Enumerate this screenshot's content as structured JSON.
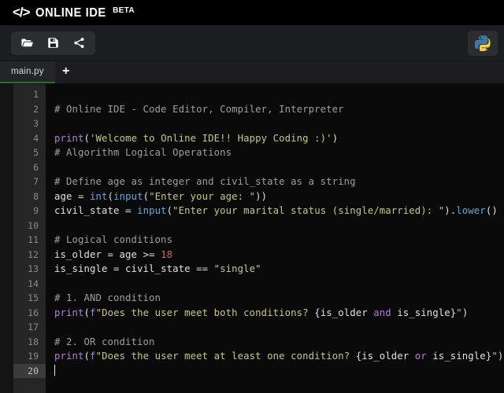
{
  "header": {
    "code_glyph": "</>",
    "title": "ONLINE IDE",
    "badge": "BETA"
  },
  "toolbar": {
    "buttons": [
      {
        "name": "open-file-button",
        "icon": "folder-open-icon",
        "label": "Open"
      },
      {
        "name": "save-file-button",
        "icon": "save-icon",
        "label": "Save"
      },
      {
        "name": "share-button",
        "icon": "share-icon",
        "label": "Share"
      }
    ],
    "language_badge": {
      "icon": "python-logo-icon",
      "label": "Python"
    }
  },
  "tabs": {
    "items": [
      {
        "label": "main.py",
        "active": true
      }
    ],
    "add_label": "+"
  },
  "editor": {
    "language": "python",
    "active_line": 20,
    "total_lines": 20,
    "line_numbers": [
      1,
      2,
      3,
      4,
      5,
      6,
      7,
      8,
      9,
      10,
      11,
      12,
      13,
      14,
      15,
      16,
      17,
      18,
      19,
      20
    ],
    "lines": [
      {
        "num": 1,
        "text": ""
      },
      {
        "num": 2,
        "text": "# Online IDE - Code Editor, Compiler, Interpreter"
      },
      {
        "num": 3,
        "text": ""
      },
      {
        "num": 4,
        "text": "print('Welcome to Online IDE!! Happy Coding :)')"
      },
      {
        "num": 5,
        "text": "# Algorithm Logical Operations"
      },
      {
        "num": 6,
        "text": ""
      },
      {
        "num": 7,
        "text": "# Define age as integer and civil_state as a string"
      },
      {
        "num": 8,
        "text": "age = int(input(\"Enter your age: \"))"
      },
      {
        "num": 9,
        "text": "civil_state = input(\"Enter your marital status (single/married): \").lower()"
      },
      {
        "num": 10,
        "text": ""
      },
      {
        "num": 11,
        "text": "# Logical conditions"
      },
      {
        "num": 12,
        "text": "is_older = age >= 18"
      },
      {
        "num": 13,
        "text": "is_single = civil_state == \"single\""
      },
      {
        "num": 14,
        "text": ""
      },
      {
        "num": 15,
        "text": "# 1. AND condition"
      },
      {
        "num": 16,
        "text": "print(f\"Does the user meet both conditions? {is_older and is_single}\")"
      },
      {
        "num": 17,
        "text": ""
      },
      {
        "num": 18,
        "text": "# 2. OR condition"
      },
      {
        "num": 19,
        "text": "print(f\"Does the user meet at least one condition? {is_older or is_single}\")"
      },
      {
        "num": 20,
        "text": ""
      }
    ]
  },
  "colors": {
    "header_bg": "#000000",
    "toolbar_bg": "#1b1d21",
    "tool_group_bg": "#2b2d31",
    "tab_active_bg": "#232529",
    "tab_underline": "#2f6b33",
    "editor_bg": "#0a0a0a",
    "gutter_bg": "#262626",
    "active_line_gutter_bg": "#3b3b3b",
    "comment": "#9e9e9e",
    "keyword": "#b07fd6",
    "builtin": "#5fa8dd",
    "string": "#c8c87a",
    "number": "#c96a5a",
    "text": "#e0e0e0",
    "python_blue": "#3c78a8",
    "python_yellow": "#ffd140"
  }
}
